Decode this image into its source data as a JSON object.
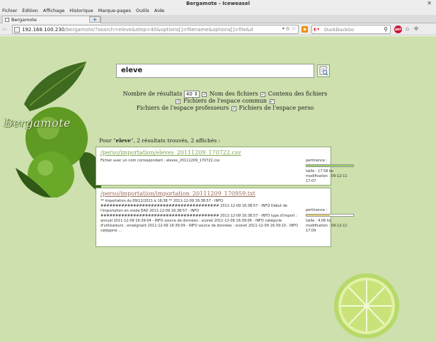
{
  "window": {
    "title": "Bergamote - Iceweasel"
  },
  "menu": [
    "Fichier",
    "Édition",
    "Affichage",
    "Historique",
    "Marque-pages",
    "Outils",
    "Aide"
  ],
  "tab": {
    "label": "Bergamote",
    "new_tab": "+"
  },
  "nav": {
    "url_host": "192.168.100.230",
    "url_path": "/bergamote/?search=eleve&step=40&options[]=filename&options[]=file&d",
    "search_engine": "DuckDuckGo",
    "search_placeholder": "DuckDuckGo"
  },
  "logo": {
    "text": "Bergamote"
  },
  "search": {
    "query": "eleve"
  },
  "options": {
    "nb_label": "Nombre de résultats",
    "nb_value": "40",
    "opt_filename": "Nom des fichiers",
    "opt_content": "Contenu des fichiers",
    "opt_common": "Fichiers de l'espace commun",
    "opt_prof": "Fichiers de l'espace professeurs",
    "opt_perso": "Fichiers de l'espace perso"
  },
  "summary": {
    "prefix": "Pour \"",
    "term": "eleve",
    "suffix": "\", 2 résultats trouvés, 2 affichés :"
  },
  "results": [
    {
      "title": "/perso/importation/eleves_20111209_170722.csv",
      "snippet": "Fichier avec un nom correspondant : eleves_20111209_170722.csv",
      "pertinence_label": "pertinence :",
      "pertinence": 1.0,
      "bar_color": "#9bd06a",
      "taille": "taille : 17.58 ko",
      "modification": "modification : 09-12-11 17:07"
    },
    {
      "title": "/perso/importation/importation_20111209_170959.txt",
      "snippet": "** importation du 09/12/2011 à 16:38 ** 2011-12-09 16:38:57 - INFO ######################################## 2011-12-09 16:38:57 - INFO Début de l'importation en mode EAD 2011-12-09 16:38:57 - INFO ######################################## 2011-12-09 16:38:57 - INFO type d'import : annuel 2011-12-09 16:39:04 - INFO source de données : sconet 2011-12-09 16:39:06 - INFO catégorie d'utilisateurs : enseignant 2011-12-09 16:39:09 - INFO source de données : sconet 2011-12-09 16:39:10 - INFO catégorie ...",
      "pertinence_label": "pertinence :",
      "pertinence": 0.5,
      "bar_color": "#e8d27a",
      "taille": "taille : 4.06 ko",
      "modification": "modification : 09-12-11 17:09"
    }
  ],
  "icons": {
    "back": "back-arrow-icon",
    "site": "page-icon",
    "bookmark": "star-icon",
    "feed": "rss-icon",
    "search": "magnifier-icon",
    "adblock": "adblock-icon",
    "search_button": "search-document-icon"
  }
}
